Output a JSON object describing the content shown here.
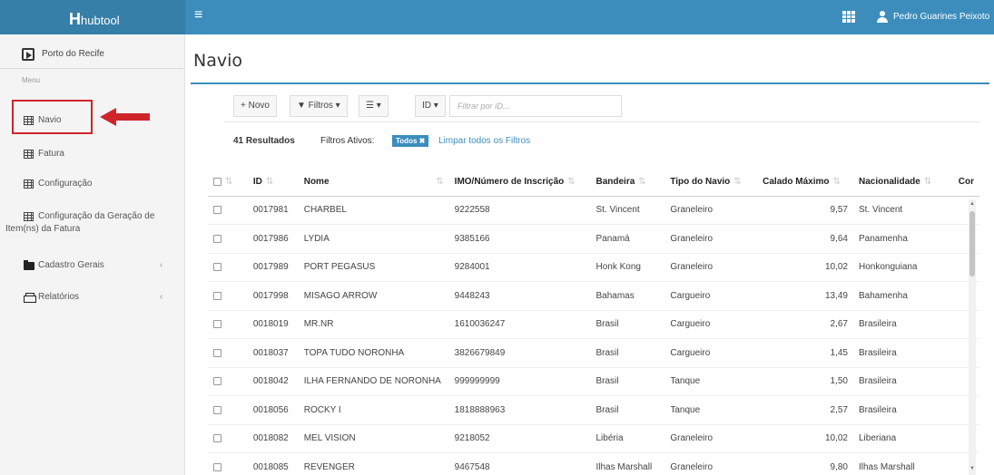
{
  "app": {
    "brand_prefix": "H",
    "brand_rest": "hubtool",
    "menu_icon": "hamburger-icon",
    "user_name": "Pedro Guarines Peixoto"
  },
  "sidebar": {
    "title": "Porto do Recife",
    "header": "Menu",
    "items": [
      {
        "label": "Navio",
        "icon": "grid-icon"
      },
      {
        "label": "Fatura",
        "icon": "grid-icon"
      },
      {
        "label": "Configuração",
        "icon": "grid-icon"
      },
      {
        "label_line1": "Configuração da Geração de",
        "label_line2": "Item(ns) da Fatura",
        "icon": "grid-icon"
      },
      {
        "label": "Cadastro Gerais",
        "icon": "folder-icon",
        "caret": "‹"
      },
      {
        "label": "Relatórios",
        "icon": "print-icon",
        "caret": "‹"
      }
    ],
    "highlight_color": "#d0242b"
  },
  "page": {
    "title": "Navio",
    "toolbar": {
      "new_label": "+ Novo",
      "filters_label": "▼ Filtros ▾",
      "columns_label": "☰ ▾",
      "field_label": "ID ▾",
      "filter_placeholder": "Filtrar por ID..."
    },
    "results": "41 Resultados",
    "active_filters_label": "Filtros Ativos:",
    "active_filter_tag": "Todos ✖",
    "clear_filters": "Limpar todos os Filtros"
  },
  "table": {
    "sort_glyph": "⇅",
    "columns": [
      "ID",
      "Nome",
      "IMO/Número de Inscrição",
      "Bandeira",
      "Tipo do Navio",
      "Calado Máximo",
      "Nacionalidade",
      "Cor"
    ],
    "rows": [
      [
        "0017981",
        "CHARBEL",
        "9222558",
        "St. Vincent",
        "Graneleiro",
        "9,57",
        "St. Vincent"
      ],
      [
        "0017986",
        "LYDIA",
        "9385166",
        "Panamá",
        "Graneleiro",
        "9,64",
        "Panamenha"
      ],
      [
        "0017989",
        "PORT PEGASUS",
        "9284001",
        "Honk Kong",
        "Graneleiro",
        "10,02",
        "Honkonguiana"
      ],
      [
        "0017998",
        "MISAGO ARROW",
        "9448243",
        "Bahamas",
        "Cargueiro",
        "13,49",
        "Bahamenha"
      ],
      [
        "0018019",
        "MR.NR",
        "1610036247",
        "Brasil",
        "Cargueiro",
        "2,67",
        "Brasileira"
      ],
      [
        "0018037",
        "TOPA TUDO NORONHA",
        "3826679849",
        "Brasil",
        "Cargueiro",
        "1,45",
        "Brasileira"
      ],
      [
        "0018042",
        "ILHA FERNANDO DE NORONHA",
        "999999999",
        "Brasil",
        "Tanque",
        "1,50",
        "Brasileira"
      ],
      [
        "0018056",
        "ROCKY I",
        "1818888963",
        "Brasil",
        "Tanque",
        "2,57",
        "Brasileira"
      ],
      [
        "0018082",
        "MEL VISION",
        "9218052",
        "Libéria",
        "Graneleiro",
        "10,02",
        "Liberiana"
      ],
      [
        "0018085",
        "REVENGER",
        "9467548",
        "Ilhas Marshall",
        "Graneleiro",
        "9,80",
        "Ilhas Marshall"
      ]
    ]
  },
  "colors": {
    "header": "#3c8dbc",
    "brand": "#367fa9",
    "sidebar": "#f4f4f5"
  }
}
